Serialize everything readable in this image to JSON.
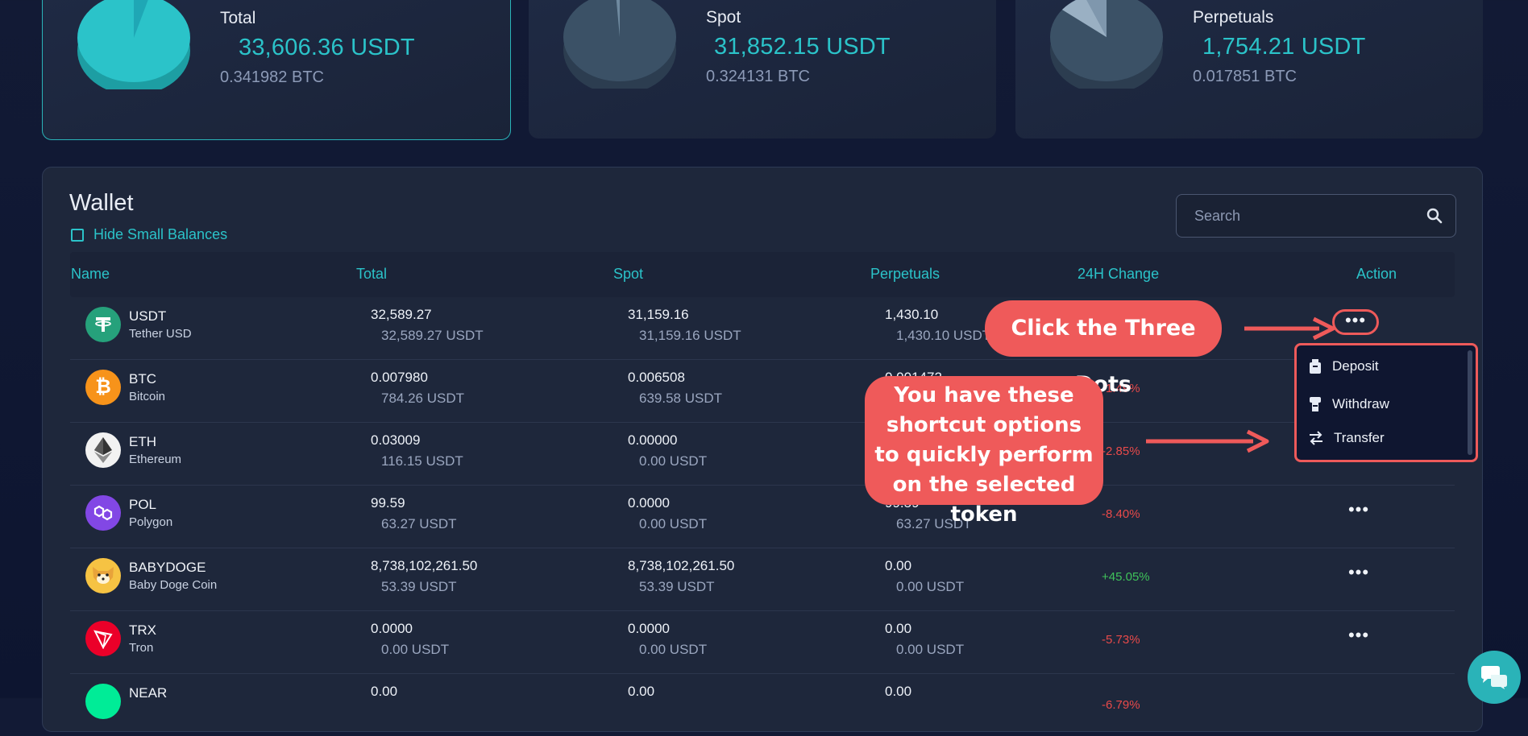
{
  "summary_cards": [
    {
      "title": "Total",
      "amount": "33,606.36 USDT",
      "btc": "0.341982 BTC"
    },
    {
      "title": "Spot",
      "amount": "31,852.15  USDT",
      "btc": "0.324131 BTC"
    },
    {
      "title": "Perpetuals",
      "amount": "1,754.21 USDT",
      "btc": "0.017851 BTC"
    }
  ],
  "wallet": {
    "title": "Wallet",
    "hide_small_label": "Hide Small Balances",
    "search_placeholder": "Search",
    "columns": [
      "Name",
      "Total",
      "Spot",
      "Perpetuals",
      "24H Change",
      "Action"
    ],
    "rows": [
      {
        "symbol": "USDT",
        "name": "Tether USD",
        "total": "32,589.27",
        "total_usdt": "32,589.27 USDT",
        "spot": "31,159.16",
        "spot_usdt": "31,159.16 USDT",
        "perp": "1,430.10",
        "perp_usdt": "1,430.10 USDT",
        "change": ""
      },
      {
        "symbol": "BTC",
        "name": "Bitcoin",
        "total": "0.007980",
        "total_usdt": "784.26 USDT",
        "spot": "0.006508",
        "spot_usdt": "639.58 USDT",
        "perp": "0.001472",
        "perp_usdt": "",
        "change": "-1.49%"
      },
      {
        "symbol": "ETH",
        "name": "Ethereum",
        "total": "0.03009",
        "total_usdt": "116.15 USDT",
        "spot": "0.00000",
        "spot_usdt": "0.00 USDT",
        "perp": "",
        "perp_usdt": "",
        "change": "-2.85%"
      },
      {
        "symbol": "POL",
        "name": "Polygon",
        "total": "99.59",
        "total_usdt": "63.27 USDT",
        "spot": "0.0000",
        "spot_usdt": "0.00 USDT",
        "perp": "99.59",
        "perp_usdt": "63.27 USDT",
        "change": "-8.40%"
      },
      {
        "symbol": "BABYDOGE",
        "name": "Baby Doge Coin",
        "total": "8,738,102,261.50",
        "total_usdt": "53.39 USDT",
        "spot": "8,738,102,261.50",
        "spot_usdt": "53.39 USDT",
        "perp": "0.00",
        "perp_usdt": "0.00 USDT",
        "change": "+45.05%"
      },
      {
        "symbol": "TRX",
        "name": "Tron",
        "total": "0.0000",
        "total_usdt": "0.00 USDT",
        "spot": "0.0000",
        "spot_usdt": "0.00 USDT",
        "perp": "0.00",
        "perp_usdt": "0.00 USDT",
        "change": "-5.73%"
      },
      {
        "symbol": "NEAR",
        "name": "",
        "total": "0.00",
        "total_usdt": "",
        "spot": "0.00",
        "spot_usdt": "",
        "perp": "0.00",
        "perp_usdt": "",
        "change": "-6.79%"
      }
    ],
    "action_menu": [
      "Deposit",
      "Withdraw",
      "Transfer"
    ]
  },
  "callouts": {
    "click": "Click the Three Dots",
    "shortcut": "You have these shortcut options to quickly perform on the selected token"
  },
  "colors": {
    "accent": "#2bc3c9",
    "negative": "#e84a4a",
    "positive": "#3fc25a",
    "callout": "#ef5a5a"
  }
}
